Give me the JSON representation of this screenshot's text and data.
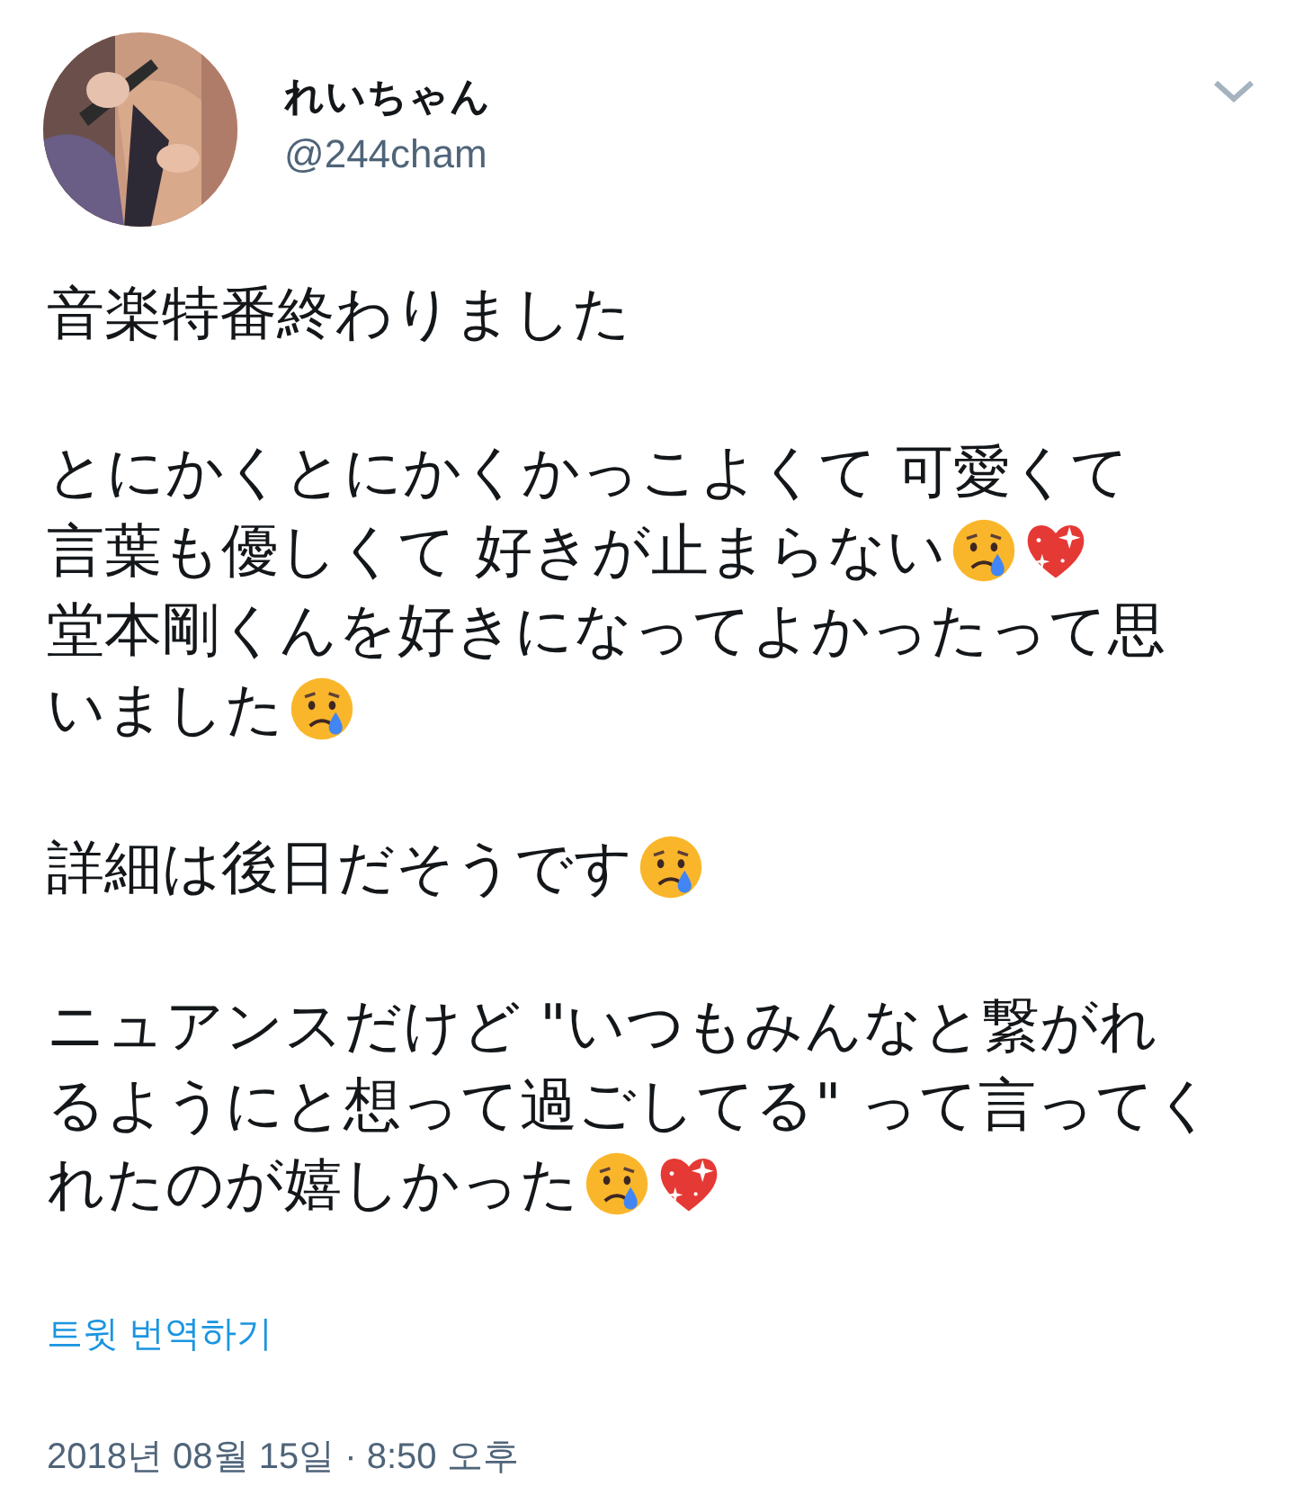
{
  "author": {
    "name": "れいちゃん",
    "handle": "@244cham"
  },
  "paragraphs": [
    {
      "lines": [
        {
          "parts": [
            {
              "kind": "text",
              "text": "音楽特番終わりました"
            }
          ]
        }
      ]
    },
    {
      "lines": [
        {
          "parts": [
            {
              "kind": "text",
              "text": "とにかくとにかくかっこよくて 可愛くて"
            }
          ]
        },
        {
          "parts": [
            {
              "kind": "text",
              "text": "言葉も優しくて 好きが止まらない"
            },
            {
              "kind": "crying-face"
            },
            {
              "kind": "sparkling-heart"
            }
          ]
        },
        {
          "parts": [
            {
              "kind": "text",
              "text": "堂本剛くんを好きになってよかったって思"
            }
          ]
        },
        {
          "parts": [
            {
              "kind": "text",
              "text": "いました"
            },
            {
              "kind": "crying-face"
            }
          ]
        }
      ]
    },
    {
      "lines": [
        {
          "parts": [
            {
              "kind": "text",
              "text": "詳細は後日だそうです"
            },
            {
              "kind": "crying-face"
            }
          ]
        }
      ]
    },
    {
      "lines": [
        {
          "parts": [
            {
              "kind": "text",
              "text": "ニュアンスだけど \"いつもみんなと繋がれ"
            }
          ]
        },
        {
          "parts": [
            {
              "kind": "text",
              "text": "るようにと想って過ごしてる\" って言ってく"
            }
          ]
        },
        {
          "parts": [
            {
              "kind": "text",
              "text": "れたのが嬉しかった"
            },
            {
              "kind": "crying-face"
            },
            {
              "kind": "sparkling-heart"
            }
          ]
        }
      ]
    }
  ],
  "translate_link": "트윗 번역하기",
  "timestamp": "2018년 08월 15일 · 8:50 오후"
}
